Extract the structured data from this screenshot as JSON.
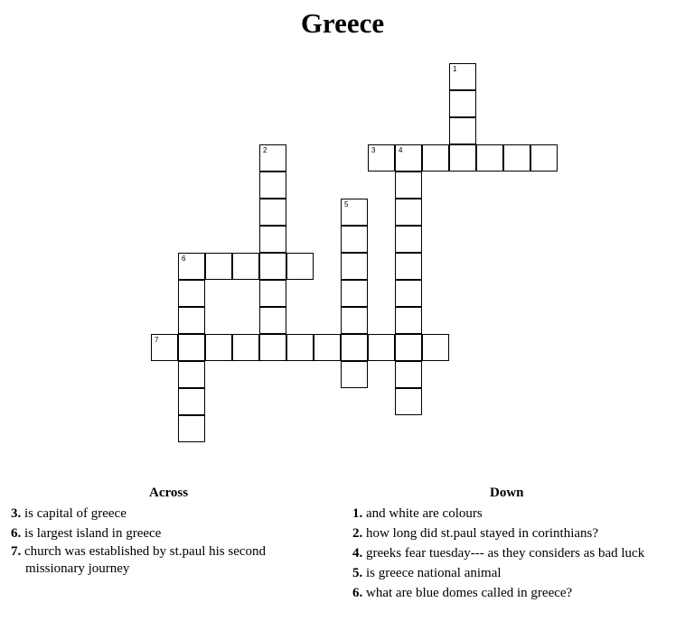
{
  "title": "Greece",
  "across_heading": "Across",
  "down_heading": "Down",
  "across": [
    {
      "num": "3.",
      "text": "is capital of greece"
    },
    {
      "num": "6.",
      "text": "is largest island in greece"
    },
    {
      "num": "7.",
      "text": "church was established by st.paul his second",
      "text2": "missionary journey"
    }
  ],
  "down": [
    {
      "num": "1.",
      "text": "and white are colours"
    },
    {
      "num": "2.",
      "text": "how long did st.paul stayed in corinthians?"
    },
    {
      "num": "4.",
      "text": "greeks fear tuesday--- as they considers as bad luck"
    },
    {
      "num": "5.",
      "text": "is greece national animal"
    },
    {
      "num": "6.",
      "text": "what are blue domes called in greece?"
    }
  ],
  "cell_numbers": {
    "1": "1",
    "2": "2",
    "3": "3",
    "4": "4",
    "5": "5",
    "6": "6",
    "7": "7"
  }
}
